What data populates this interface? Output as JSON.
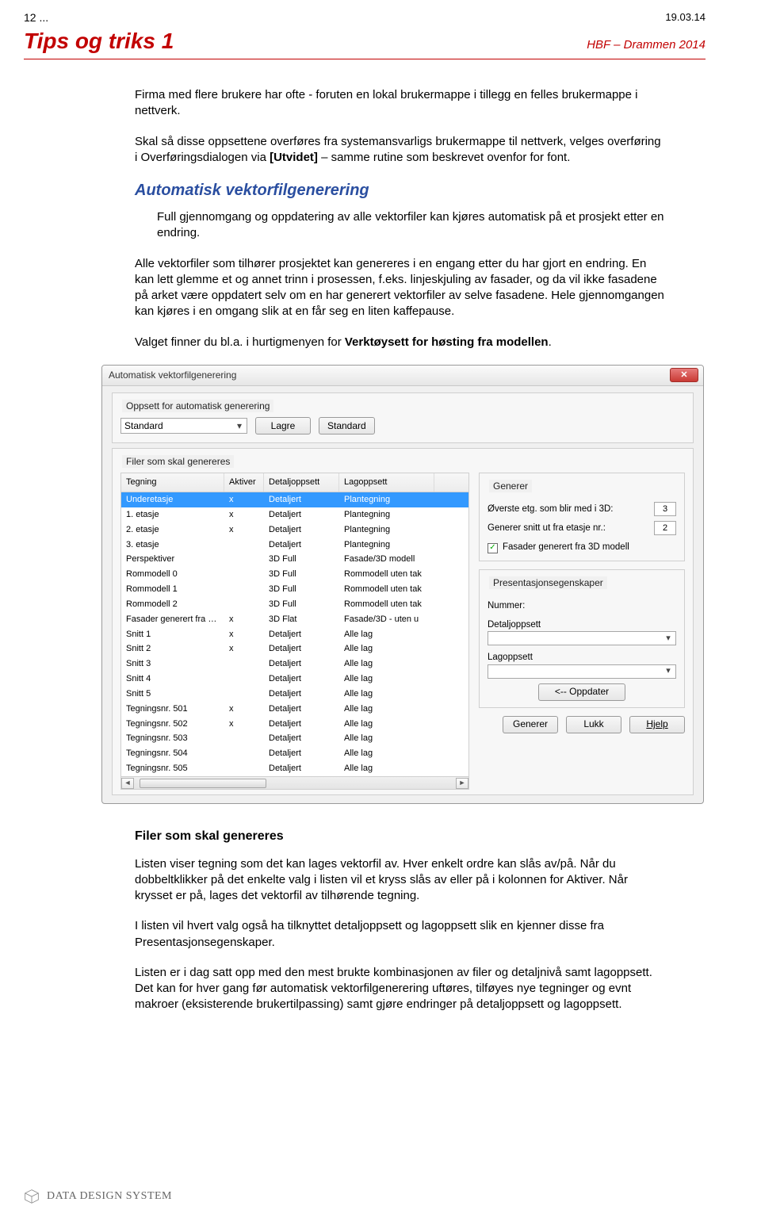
{
  "header": {
    "left_top": "12 ...",
    "right_top": "19.03.14",
    "title": "Tips og triks 1",
    "subtitle": "HBF – Drammen 2014"
  },
  "intro": {
    "p1": "Firma med flere brukere har ofte - foruten en lokal brukermappe i tillegg en felles brukermappe i nettverk.",
    "p2a": "Skal så disse oppsettene overføres fra systemansvarligs brukermappe til nettverk, velges overføring i Overføringsdialogen via ",
    "p2_bold": "[Utvidet]",
    "p2b": " – samme rutine som beskrevet ovenfor for font."
  },
  "sec1": {
    "heading": "Automatisk vektorfilgenerering",
    "p1": "Full gjennomgang og oppdatering av alle vektorfiler kan kjøres automatisk på et prosjekt etter en endring.",
    "p2": "Alle vektorfiler som tilhører prosjektet kan genereres i en engang etter du har gjort en endring. En kan lett glemme et og annet trinn i prosessen, f.eks. linjeskjuling av fasader, og da vil ikke fasadene på arket være oppdatert selv om en har generert vektorfiler av selve fasadene. Hele gjennomgangen kan kjøres i en omgang slik at en får seg en liten kaffepause.",
    "p3a": "Valget finner du bl.a. i hurtigmenyen for ",
    "p3_bold": "Verktøysett for høsting fra modellen",
    "p3b": "."
  },
  "dialog": {
    "title": "Automatisk vektorfilgenerering",
    "group_setup_title": "Oppsett for automatisk generering",
    "combo_value": "Standard",
    "btn_lagre": "Lagre",
    "btn_standard": "Standard",
    "group_files_title": "Filer som skal genereres",
    "table": {
      "headers": [
        "Tegning",
        "Aktiver",
        "Detaljoppsett",
        "Lagoppsett"
      ],
      "rows": [
        {
          "t": "Underetasje",
          "a": "x",
          "d": "Detaljert",
          "l": "Plantegning",
          "sel": true
        },
        {
          "t": "1. etasje",
          "a": "x",
          "d": "Detaljert",
          "l": "Plantegning"
        },
        {
          "t": "2. etasje",
          "a": "x",
          "d": "Detaljert",
          "l": "Plantegning"
        },
        {
          "t": "3. etasje",
          "a": "",
          "d": "Detaljert",
          "l": "Plantegning"
        },
        {
          "t": "Perspektiver",
          "a": "",
          "d": "3D Full",
          "l": "Fasade/3D modell"
        },
        {
          "t": "Rommodell 0",
          "a": "",
          "d": "3D Full",
          "l": "Rommodell uten tak"
        },
        {
          "t": "Rommodell 1",
          "a": "",
          "d": "3D Full",
          "l": "Rommodell uten tak"
        },
        {
          "t": "Rommodell 2",
          "a": "",
          "d": "3D Full",
          "l": "Rommodell uten tak"
        },
        {
          "t": "Fasader generert fra 3...",
          "a": "x",
          "d": "3D Flat",
          "l": "Fasade/3D - uten u"
        },
        {
          "t": "Snitt 1",
          "a": "x",
          "d": "Detaljert",
          "l": "Alle lag"
        },
        {
          "t": "Snitt 2",
          "a": "x",
          "d": "Detaljert",
          "l": "Alle lag"
        },
        {
          "t": "Snitt 3",
          "a": "",
          "d": "Detaljert",
          "l": "Alle lag"
        },
        {
          "t": "Snitt 4",
          "a": "",
          "d": "Detaljert",
          "l": "Alle lag"
        },
        {
          "t": "Snitt 5",
          "a": "",
          "d": "Detaljert",
          "l": "Alle lag"
        },
        {
          "t": "Tegningsnr. 501",
          "a": "x",
          "d": "Detaljert",
          "l": "Alle lag"
        },
        {
          "t": "Tegningsnr. 502",
          "a": "x",
          "d": "Detaljert",
          "l": "Alle lag"
        },
        {
          "t": "Tegningsnr. 503",
          "a": "",
          "d": "Detaljert",
          "l": "Alle lag"
        },
        {
          "t": "Tegningsnr. 504",
          "a": "",
          "d": "Detaljert",
          "l": "Alle lag"
        },
        {
          "t": "Tegningsnr. 505",
          "a": "",
          "d": "Detaljert",
          "l": "Alle lag"
        }
      ]
    },
    "right": {
      "group_generer": "Generer",
      "lbl_overste": "Øverste etg. som blir med i 3D:",
      "val_overste": "3",
      "lbl_snitt": "Generer snitt ut fra etasje nr.:",
      "val_snitt": "2",
      "chk_label": "Fasader generert fra 3D modell",
      "chk_checked": "✓",
      "group_pres": "Presentasjonsegenskaper",
      "lbl_nummer": "Nummer:",
      "lbl_detalj": "Detaljoppsett",
      "lbl_lag": "Lagoppsett",
      "btn_oppdater": "<-- Oppdater"
    },
    "buttons": {
      "generer": "Generer",
      "lukk": "Lukk",
      "hjelp": "Hjelp"
    }
  },
  "sec2": {
    "heading": "Filer som skal genereres",
    "p1": "Listen viser tegning som det kan lages vektorfil av. Hver enkelt ordre kan slås av/på. Når du dobbeltklikker på det enkelte valg i listen vil et kryss slås av eller på i kolonnen for Aktiver. Når krysset er på, lages det vektorfil av tilhørende tegning.",
    "p2": "I listen vil hvert valg også ha tilknyttet detaljoppsett og lagoppsett slik en kjenner disse fra Presentasjonsegenskaper.",
    "p3": "Listen er i dag satt opp med den mest brukte kombinasjonen av filer og detaljnivå samt lagoppsett. Det kan for hver gang før automatisk vektorfilgenerering uftøres, tilføyes nye tegninger og evnt makroer (eksisterende brukertilpassing) samt gjøre endringer på detaljoppsett og lagoppsett."
  },
  "footer": {
    "text": "DATA DESIGN SYSTEM"
  }
}
